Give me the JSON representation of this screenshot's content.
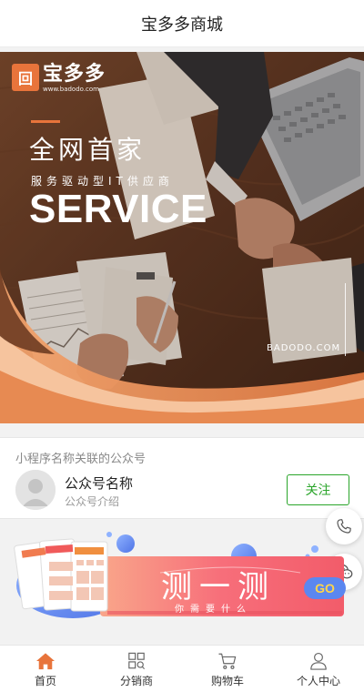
{
  "nav": {
    "title": "宝多多商城"
  },
  "banner": {
    "logo_mark": "回",
    "logo_name": "宝多多",
    "logo_url": "www.badodo.com",
    "headline": "全网首家",
    "subheadline": "服务驱动型IT供应商",
    "big_text": "SERVICE",
    "brand": "BADODO.COM",
    "accent_color": "#e8743b"
  },
  "official_account": {
    "label": "小程序名称关联的公众号",
    "name": "公众号名称",
    "description": "公众号介绍",
    "follow_label": "关注",
    "follow_color": "#2aa52a"
  },
  "floating": {
    "phone_icon": "phone-icon",
    "chat_icon": "chat-icon"
  },
  "promo": {
    "title": "测一测",
    "subtitle": "你需要什么",
    "go_label": "GO"
  },
  "tabbar": {
    "active_color": "#e8743b",
    "items": [
      {
        "label": "首页",
        "icon": "home-icon",
        "active": true
      },
      {
        "label": "分销商",
        "icon": "grid-search-icon",
        "active": false
      },
      {
        "label": "购物车",
        "icon": "cart-icon",
        "active": false
      },
      {
        "label": "个人中心",
        "icon": "user-icon",
        "active": false
      }
    ]
  }
}
